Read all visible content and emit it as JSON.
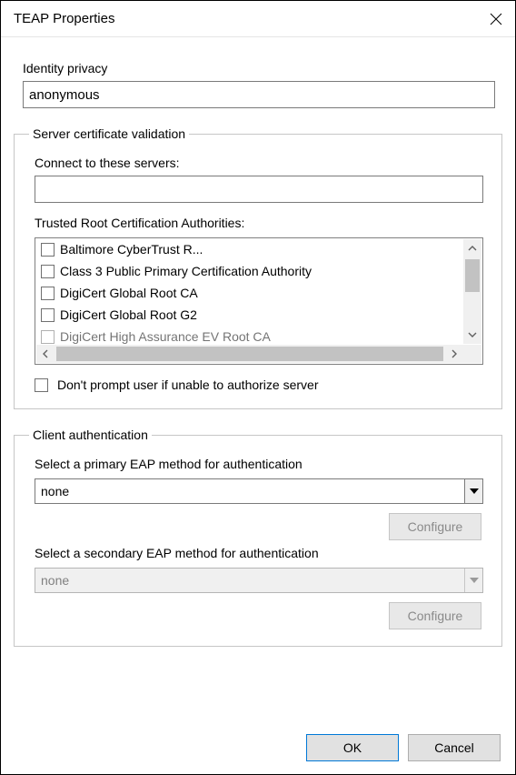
{
  "window": {
    "title": "TEAP Properties"
  },
  "identity": {
    "label": "Identity privacy",
    "value": "anonymous"
  },
  "server_cert": {
    "legend": "Server certificate validation",
    "connect_label": "Connect to these servers:",
    "connect_value": "",
    "authorities_label": "Trusted Root Certification Authorities:",
    "authorities": [
      "Baltimore CyberTrust R...",
      "Class 3 Public Primary Certification Authority",
      "DigiCert Global Root CA",
      "DigiCert Global Root G2",
      "DigiCert High Assurance EV Root CA"
    ],
    "dont_prompt_label": "Don't prompt user if unable to authorize server"
  },
  "client_auth": {
    "legend": "Client authentication",
    "primary_label": "Select a primary EAP method for authentication",
    "primary_value": "none",
    "secondary_label": "Select a secondary EAP method for authentication",
    "secondary_value": "none",
    "configure_label": "Configure"
  },
  "buttons": {
    "ok": "OK",
    "cancel": "Cancel"
  }
}
